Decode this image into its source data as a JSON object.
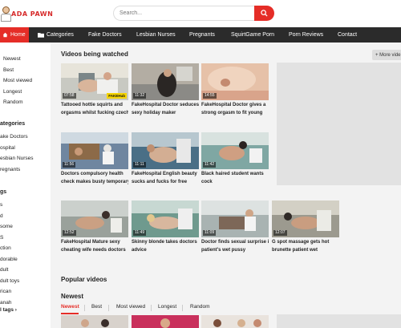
{
  "site": {
    "logo_text": "ADA PAWN"
  },
  "search": {
    "placeholder": "Search..."
  },
  "nav": {
    "items": [
      {
        "label": "Home",
        "icon": "home-icon"
      },
      {
        "label": "Categories",
        "icon": "folder-icon"
      },
      {
        "label": "Fake Doctors"
      },
      {
        "label": "Lesbian Nurses"
      },
      {
        "label": "Pregnants"
      },
      {
        "label": "SquirtGame Porn"
      },
      {
        "label": "Porn Reviews"
      },
      {
        "label": "Contact"
      }
    ]
  },
  "sidebar": {
    "sort_links": [
      "Newest",
      "Best",
      "Most viewed",
      "Longest",
      "Random"
    ],
    "categories_title": "ategories",
    "categories": [
      "ake Doctors",
      "ospital",
      "esbian Nurses",
      "regnants"
    ],
    "tags_title": "gs",
    "tags": [
      "s",
      "d",
      "some",
      "S",
      "ction",
      "dorable",
      "dult",
      "dult toys",
      "rican",
      "anah"
    ],
    "all_tags": "l tags ›"
  },
  "main": {
    "watched_title": "Videos being watched",
    "more_label": "+ More vide",
    "popular_title": "Popular videos",
    "newest_title": "Newest",
    "tabs": [
      "Newest",
      "Best",
      "Most viewed",
      "Longest",
      "Random"
    ],
    "videos": [
      {
        "duration": "07:58",
        "badge": "FAKEHub",
        "title": "Tattooed hottie squirts and",
        "title2": "orgasms whilst fucking czech"
      },
      {
        "duration": "11:32",
        "title": "FakeHospital Doctor seduces",
        "title2": "sexy holiday maker"
      },
      {
        "duration": "14:55",
        "title": "FakeHospital Doctor gives a",
        "title2": "strong orgasm to fit young"
      },
      {
        "duration": "11:56",
        "title": "Doctors compulsory health",
        "title2": "check makes busty temporary"
      },
      {
        "duration": "11:11",
        "title": "FakeHospital English beauty",
        "title2": "sucks and fucks for free"
      },
      {
        "duration": "11:42",
        "title": "Black haired student wants",
        "title2": "cock"
      },
      {
        "duration": "12:52",
        "title": "FakeHospital Mature sexy",
        "title2": "cheating wife needs doctors"
      },
      {
        "duration": "11:49",
        "title": "Skinny blonde takes doctors",
        "title2": "advice"
      },
      {
        "duration": "11:09",
        "title": "Doctor finds sexual surprise in",
        "title2": "patient's wet pussy"
      },
      {
        "duration": "12:07",
        "title": "G spot massage gets hot",
        "title2": "brunette patient wet"
      }
    ]
  },
  "colors": {
    "accent": "#e52d27",
    "nav_bg": "#2b2b2b",
    "page_bg": "#f3f3f3"
  }
}
